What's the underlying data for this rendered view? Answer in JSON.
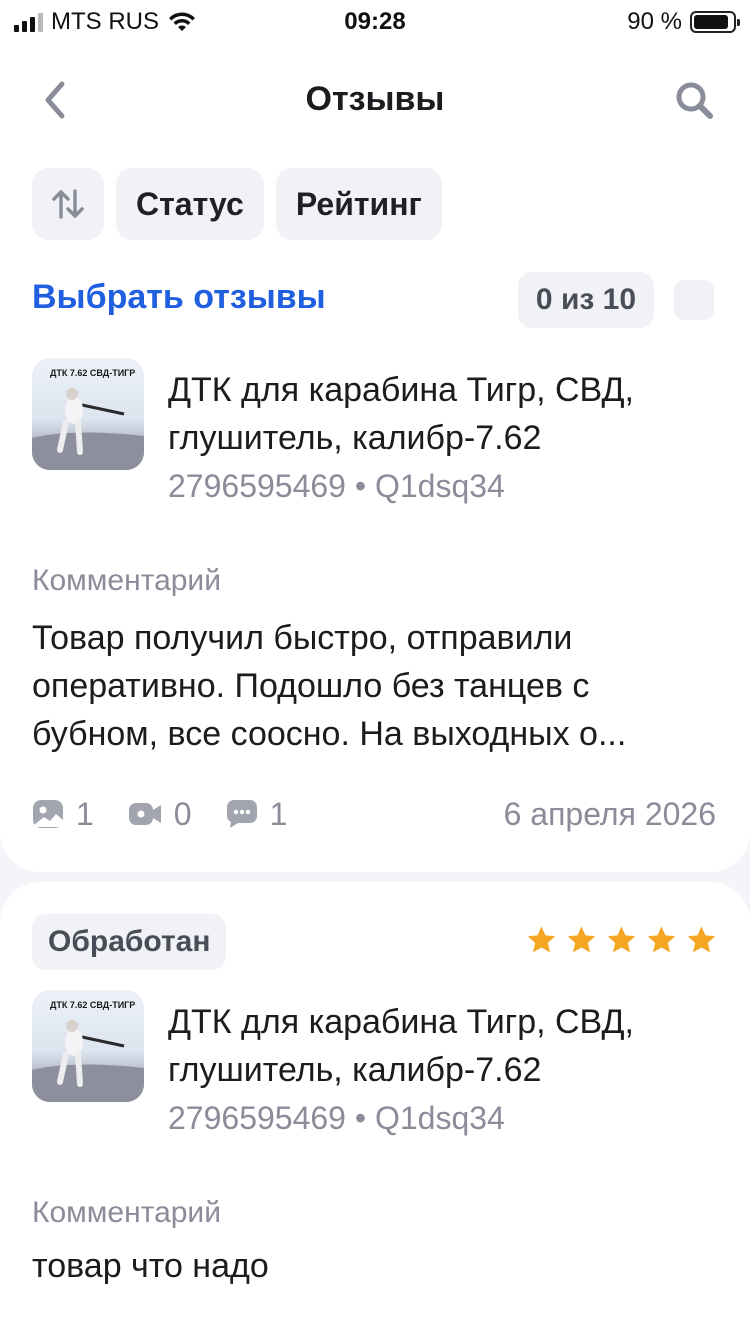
{
  "status_bar": {
    "carrier": "MTS RUS",
    "time": "09:28",
    "battery": "90 %",
    "battery_level": 0.9
  },
  "nav": {
    "title": "Отзывы"
  },
  "filters": {
    "status_label": "Статус",
    "rating_label": "Рейтинг"
  },
  "selection": {
    "select_label": "Выбрать отзывы",
    "counter": "0 из 10"
  },
  "reviews": [
    {
      "product_name": "ДТК для карабина Тигр, СВД, глушитель, калибр-7.62",
      "thumb_caption": "ДТК 7.62 СВД-ТИГР",
      "meta": "2796595469 • Q1dsq34",
      "comment_label": "Комментарий",
      "comment": "Товар получил быстро, отправили оперативно. Подошло без танцев с бубном, все соосно. На выходных о...",
      "stats": {
        "photos": "1",
        "videos": "0",
        "answers": "1"
      },
      "date": "6 апреля 2026"
    },
    {
      "status": "Обработан",
      "rating": 5,
      "star_color": "#f5a623",
      "product_name": "ДТК для карабина Тигр, СВД, глушитель, калибр-7.62",
      "thumb_caption": "ДТК 7.62 СВД-ТИГР",
      "meta": "2796595469 • Q1dsq34",
      "comment_label": "Комментарий",
      "comment": "товар что надо"
    }
  ],
  "colors": {
    "accent": "#1f5fe0",
    "muted": "#8a8d99",
    "chip_bg": "#f1f2f6"
  }
}
